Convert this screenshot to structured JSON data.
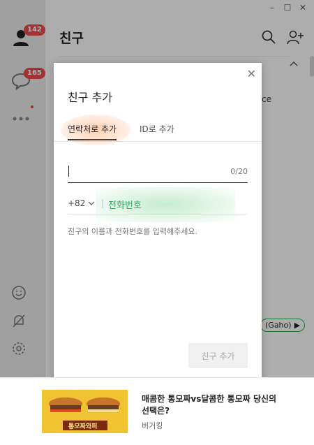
{
  "sidebar": {
    "friends_badge": "142",
    "chats_badge": "165"
  },
  "main": {
    "title": "친구",
    "bg_text_ace": "ce",
    "bg_friend_chip": "(Gaho)"
  },
  "dialog": {
    "title": "친구 추가",
    "tabs": [
      {
        "label": "연락처로 추가",
        "active": true
      },
      {
        "label": "ID로 추가",
        "active": false
      }
    ],
    "name_counter": "0/20",
    "country_code": "+82",
    "phone_placeholder": "전화번호",
    "hint": "친구의 이름과 전화번호를 입력해주세요.",
    "submit_label": "친구 추가"
  },
  "ad": {
    "title": "매콤한 통모짜vs달콤한 통모짜 당신의 선택은?",
    "brand": "버거킹",
    "image_caption": "통모짜와퍼"
  },
  "colors": {
    "badge": "#f24b4b",
    "accent_green": "#3aa55a",
    "sidebar_bg": "#ececec"
  }
}
